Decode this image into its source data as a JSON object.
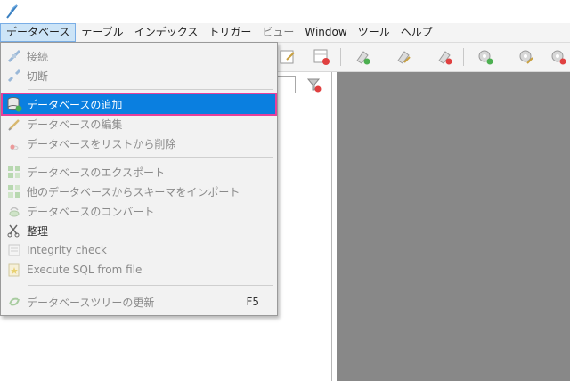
{
  "menubar": {
    "items": [
      {
        "label": "データベース",
        "state": "active"
      },
      {
        "label": "テーブル",
        "state": "normal"
      },
      {
        "label": "インデックス",
        "state": "normal"
      },
      {
        "label": "トリガー",
        "state": "normal"
      },
      {
        "label": "ビュー",
        "state": "disabled"
      },
      {
        "label": "Window",
        "state": "normal"
      },
      {
        "label": "ツール",
        "state": "normal"
      },
      {
        "label": "ヘルプ",
        "state": "normal"
      }
    ]
  },
  "database_menu": {
    "items": [
      {
        "label": "接続",
        "icon": "connect-icon",
        "state": "disabled"
      },
      {
        "label": "切断",
        "icon": "disconnect-icon",
        "state": "disabled"
      },
      {
        "label": "データベースの追加",
        "icon": "add-database-icon",
        "state": "highlighted"
      },
      {
        "label": "データベースの編集",
        "icon": "edit-database-icon",
        "state": "disabled"
      },
      {
        "label": "データベースをリストから削除",
        "icon": "remove-database-icon",
        "state": "disabled"
      },
      {
        "label": "データベースのエクスポート",
        "icon": "export-database-icon",
        "state": "disabled"
      },
      {
        "label": "他のデータベースからスキーマをインポート",
        "icon": "import-schema-icon",
        "state": "disabled"
      },
      {
        "label": "データベースのコンバート",
        "icon": "convert-database-icon",
        "state": "disabled"
      },
      {
        "label": "整理",
        "icon": "vacuum-icon",
        "state": "normal"
      },
      {
        "label": "Integrity check",
        "icon": "integrity-check-icon",
        "state": "disabled"
      },
      {
        "label": "Execute SQL from file",
        "icon": "execute-sql-file-icon",
        "state": "disabled"
      },
      {
        "label": "データベースツリーの更新",
        "icon": "refresh-tree-icon",
        "state": "disabled",
        "shortcut": "F5"
      }
    ]
  },
  "colors": {
    "highlight": "#0a7fe0",
    "highlight_outline": "#e8409a",
    "workspace_gray": "#888888",
    "menu_bg": "#f2f2f2"
  }
}
